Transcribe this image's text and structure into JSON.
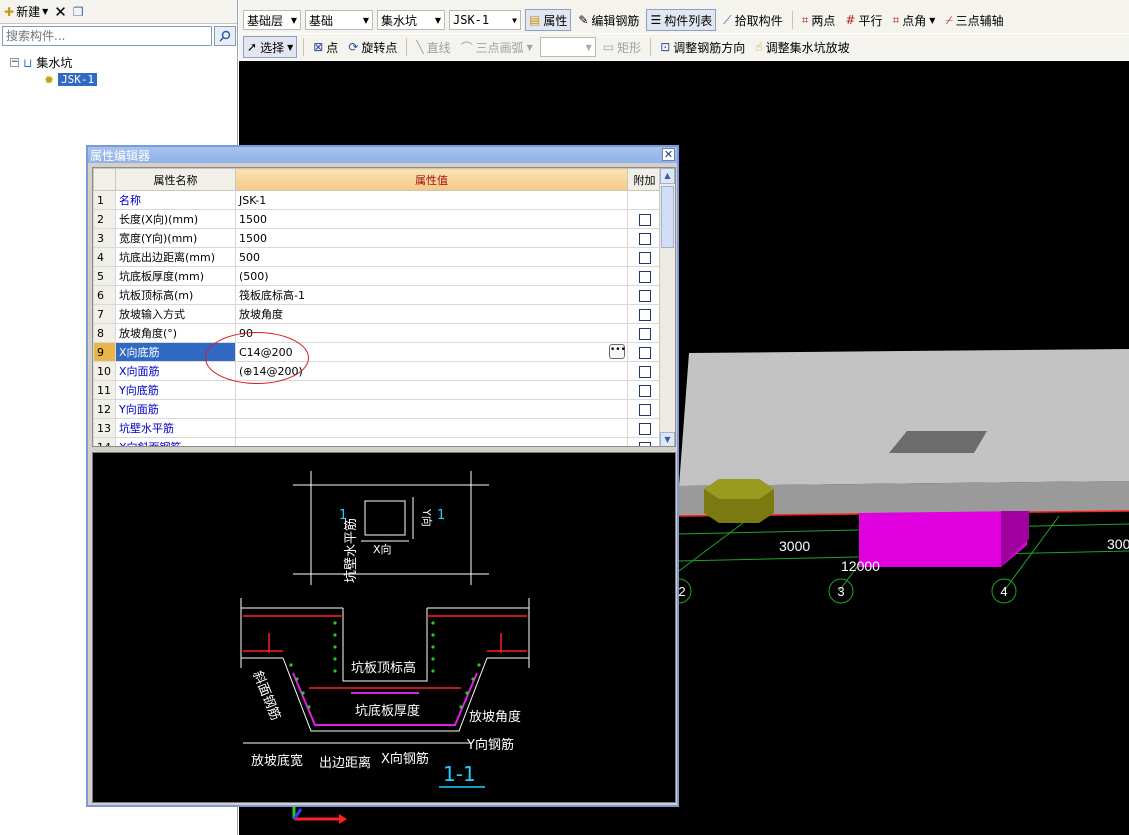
{
  "left_panel": {
    "new_label": "新建",
    "search_placeholder": "搜索构件...",
    "tree_root": "集水坑",
    "tree_child": "JSK-1"
  },
  "toolbar1": {
    "floor": "基础层",
    "category": "基础",
    "type": "集水坑",
    "component": "JSK-1",
    "properties": "属性",
    "edit_rebar": "编辑钢筋",
    "component_list": "构件列表",
    "pick_component": "拾取构件",
    "two_points": "两点",
    "parallel": "平行",
    "point_angle": "点角",
    "three_point_axis": "三点辅轴"
  },
  "toolbar2": {
    "select": "选择",
    "point": "点",
    "rotate_point": "旋转点",
    "line": "直线",
    "three_point_arc": "三点画弧",
    "rect": "矩形",
    "adjust_rebar_dir": "调整钢筋方向",
    "adjust_slope": "调整集水坑放坡"
  },
  "dialog": {
    "title": "属性编辑器",
    "headers": {
      "name": "属性名称",
      "value": "属性值",
      "extra": "附加"
    },
    "rows": [
      {
        "num": "1",
        "name": "名称",
        "value": "JSK-1",
        "blue": true,
        "has_check": false
      },
      {
        "num": "2",
        "name": "长度(X向)(mm)",
        "value": "1500",
        "blue": false,
        "has_check": true
      },
      {
        "num": "3",
        "name": "宽度(Y向)(mm)",
        "value": "1500",
        "blue": false,
        "has_check": true
      },
      {
        "num": "4",
        "name": "坑底出边距离(mm)",
        "value": "500",
        "blue": false,
        "has_check": true
      },
      {
        "num": "5",
        "name": "坑底板厚度(mm)",
        "value": "(500)",
        "blue": false,
        "has_check": true
      },
      {
        "num": "6",
        "name": "坑板顶标高(m)",
        "value": "筏板底标高-1",
        "blue": false,
        "has_check": true
      },
      {
        "num": "7",
        "name": "放坡输入方式",
        "value": "放坡角度",
        "blue": false,
        "has_check": true
      },
      {
        "num": "8",
        "name": "放坡角度(°)",
        "value": "90",
        "blue": false,
        "has_check": true
      },
      {
        "num": "9",
        "name": "X向底筋",
        "value": "C14@200",
        "blue": true,
        "has_check": true,
        "selected": true
      },
      {
        "num": "10",
        "name": "X向面筋",
        "value": "(⊕14@200)",
        "blue": true,
        "has_check": true
      },
      {
        "num": "11",
        "name": "Y向底筋",
        "value": "",
        "blue": true,
        "has_check": true
      },
      {
        "num": "12",
        "name": "Y向面筋",
        "value": "",
        "blue": true,
        "has_check": true
      },
      {
        "num": "13",
        "name": "坑壁水平筋",
        "value": "",
        "blue": true,
        "has_check": true
      },
      {
        "num": "14",
        "name": "X向斜面钢筋",
        "value": "",
        "blue": true,
        "has_check": true
      }
    ]
  },
  "preview": {
    "section_mark": "1",
    "x_dir": "X向",
    "y_dir": "Y向",
    "wall_horizontal_rebar": "坑壁水平筋",
    "pit_top_elev": "坑板顶标高",
    "slope_rebar": "斜面钢筋",
    "pit_bottom_thickness": "坑底板厚度",
    "slope_angle": "放坡角度",
    "y_rebar": "Y向钢筋",
    "slope_width": "放坡底宽",
    "edge_distance": "出边距离",
    "x_rebar": "X向钢筋",
    "section_title": "1-1"
  },
  "viewport": {
    "dim1": "3000",
    "dim2": "12000",
    "dim3": "300",
    "axis3": "3",
    "axis4": "4",
    "axis2": "2"
  },
  "colors": {
    "slab": "#c3c3c3",
    "pit": "#e000e0",
    "column": "#7a7a10",
    "axis": "#1fa32a",
    "rebar_red": "#ff2020",
    "rebar_green": "#22d022",
    "rebar_magenta": "#e020e0"
  }
}
